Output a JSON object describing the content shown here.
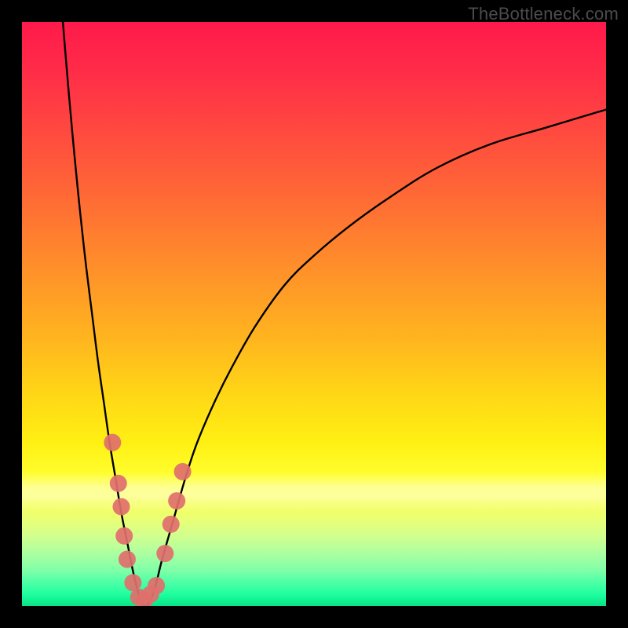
{
  "attribution": "TheBottleneck.com",
  "colors": {
    "frame_border": "#000000",
    "curve_stroke": "#000000",
    "marker_fill": "#e06f6d",
    "gradient_top": "#ff1a4b",
    "gradient_bottom": "#07e387"
  },
  "chart_data": {
    "type": "line",
    "title": "",
    "xlabel": "",
    "ylabel": "",
    "xlim": [
      0,
      100
    ],
    "ylim": [
      0,
      100
    ],
    "note": "V-shaped bottleneck curve; y is bottleneck percentage where 0 (bottom) is optimal/green and 100 (top) is worst/red. x is relative component performance. Minimum near x≈20.",
    "series": [
      {
        "name": "bottleneck-curve",
        "x": [
          7,
          8,
          9,
          10,
          11,
          12,
          13,
          14,
          15,
          16,
          17,
          18,
          19,
          20,
          21,
          22,
          23,
          24,
          26,
          28,
          30,
          33,
          36,
          40,
          45,
          50,
          56,
          63,
          71,
          80,
          90,
          100
        ],
        "y": [
          100,
          88,
          77,
          67,
          58,
          50,
          42,
          35,
          28,
          22,
          16,
          11,
          6,
          2,
          0,
          1,
          4,
          8,
          15,
          22,
          28,
          35,
          41,
          48,
          55,
          60,
          65,
          70,
          75,
          79,
          82,
          85
        ]
      }
    ],
    "markers": {
      "name": "highlighted-points",
      "points": [
        {
          "x": 15.5,
          "y": 28
        },
        {
          "x": 16.5,
          "y": 21
        },
        {
          "x": 17.0,
          "y": 17
        },
        {
          "x": 17.5,
          "y": 12
        },
        {
          "x": 18.0,
          "y": 8
        },
        {
          "x": 19.0,
          "y": 4
        },
        {
          "x": 20.0,
          "y": 1.5
        },
        {
          "x": 21.0,
          "y": 1.0
        },
        {
          "x": 22.0,
          "y": 2.0
        },
        {
          "x": 23.0,
          "y": 3.5
        },
        {
          "x": 24.5,
          "y": 9
        },
        {
          "x": 25.5,
          "y": 14
        },
        {
          "x": 26.5,
          "y": 18
        },
        {
          "x": 27.5,
          "y": 23
        }
      ]
    }
  }
}
